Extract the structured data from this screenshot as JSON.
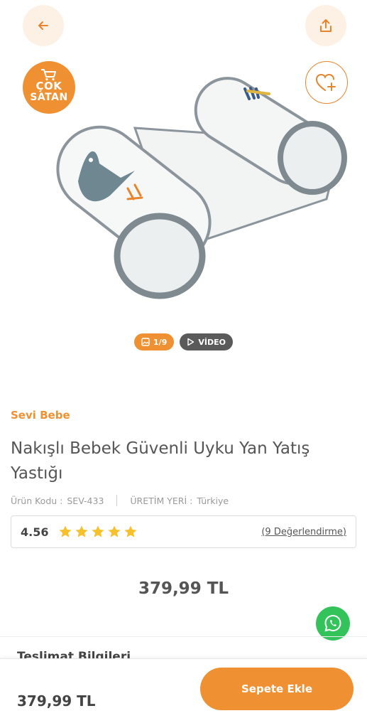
{
  "badge": {
    "line1": "ÇOK",
    "line2": "SATAN"
  },
  "gallery": {
    "photo_counter": "1/9",
    "video_label": "VİDEO"
  },
  "product": {
    "brand": "Sevi Bebe",
    "title": "Nakışlı Bebek Güvenli Uyku Yan Yatış Yastığı",
    "code_label": "Ürün Kodu :",
    "code_value": "SEV-433",
    "origin_label": "ÜRETİM YERİ :",
    "origin_value": "Türkiye",
    "rating": "4.56",
    "stars": 5,
    "reviews": "(9 Değerlendirme)",
    "price": "379,99 TL"
  },
  "section_peek": "Teslimat Bilgileri",
  "bottom_bar": {
    "price": "379,99 TL",
    "add_to_cart": "Sepete Ekle"
  },
  "colors": {
    "accent": "#ef9132",
    "whatsapp": "#34c35b",
    "video_pill": "#5a5a5a"
  }
}
